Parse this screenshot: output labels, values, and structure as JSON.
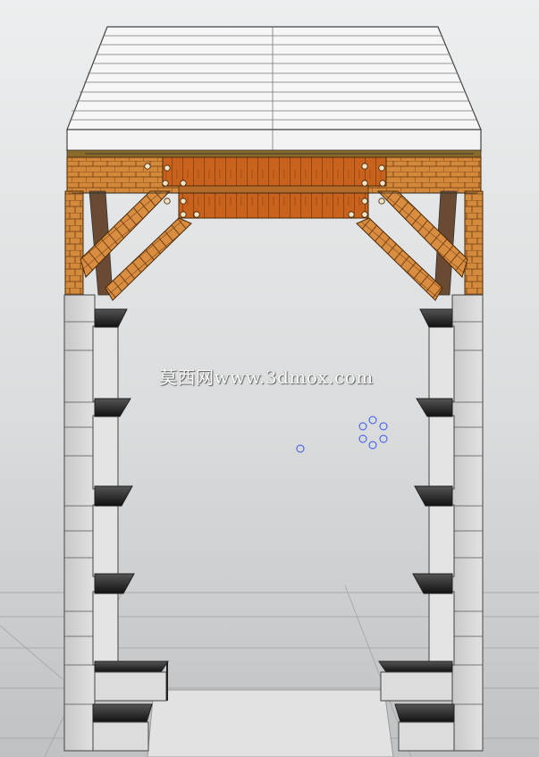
{
  "watermark": {
    "text": "莫西网www.3dmox.com"
  },
  "colors": {
    "background_top": "#e8eaeb",
    "background_bottom": "#bfc1c3",
    "roof": "#f4f4f4",
    "timber_light": "#d28a3a",
    "timber_dark": "#c4621a",
    "stone": "#d6d6d6",
    "stone_dark": "#333333",
    "gizmo": "#3355ee"
  },
  "icons": {
    "gizmo": "pivot-circles-icon"
  }
}
